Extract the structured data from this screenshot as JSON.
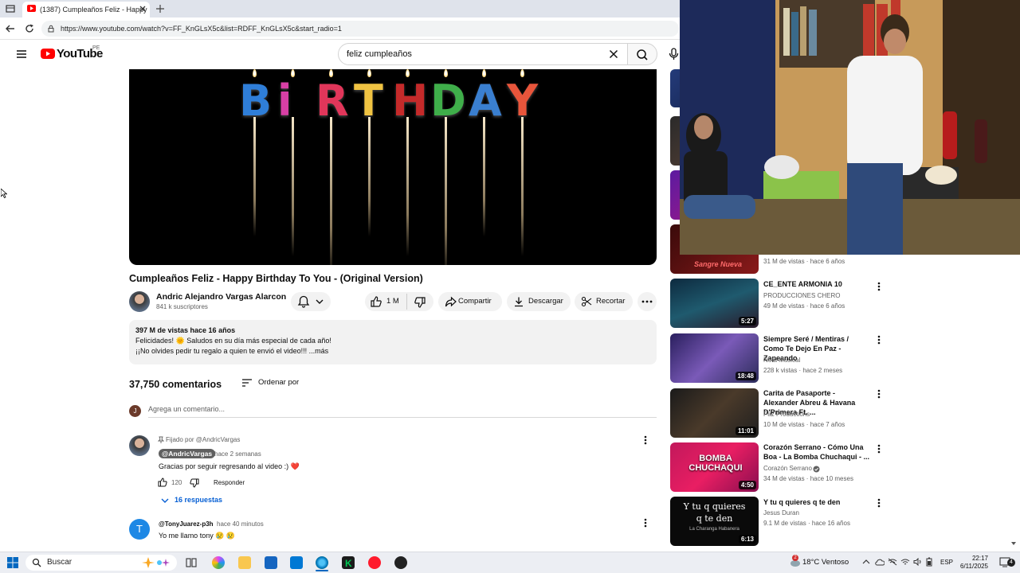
{
  "browser": {
    "tab_title": "(1387) Cumpleaños Feliz - Happy",
    "url": "https://www.youtube.com/watch?v=FF_KnGLsX5c&list=RDFF_KnGLsX5c&start_radio=1"
  },
  "header": {
    "logo_text": "YouTube",
    "country_code": "PE",
    "search_query": "feliz cumpleaños"
  },
  "player": {
    "overlay_letters": [
      "B",
      "i",
      "R",
      "T",
      "H",
      "D",
      "A",
      "Y"
    ],
    "colors": [
      "#2f7ed8",
      "#d83fa5",
      "#e1365a",
      "#f0c342",
      "#c52a2a",
      "#3fae4a",
      "#3a7fd0",
      "#e8553b"
    ]
  },
  "video": {
    "title": "Cumpleaños Feliz - Happy Birthday To You - (Original Version)",
    "channel_name": "Andric Alejandro Vargas Alarcon",
    "subscribers": "841 k suscriptores",
    "likes": "1 M",
    "share_label": "Compartir",
    "download_label": "Descargar",
    "clip_label": "Recortar"
  },
  "description": {
    "views_date": "397 M de vistas  hace 16 años",
    "line1": "Felicidades! 🌞 Saludos en su día más especial de cada año!",
    "line2": "¡¡No olvides pedir tu regalo a quien te envió el video!!! ...más"
  },
  "comments": {
    "count": "37,750 comentarios",
    "sort_label": "Ordenar por",
    "me_initial": "J",
    "add_placeholder": "Agrega un comentario...",
    "pinned": {
      "pinned_by": "Fijado por @AndricVargas",
      "author": "@AndricVargas",
      "time": "hace 2 semanas",
      "text": "Gracias por seguir regresando al video :) ❤️",
      "likes": "120",
      "reply_label": "Responder",
      "replies_label": "16 respuestas"
    },
    "second": {
      "initial": "T",
      "author": "@TonyJuarez-p3h",
      "time": "hace 40 minutos",
      "text": "Yo me llamo tony 😢 😢"
    }
  },
  "related": [
    {
      "title": "CE_ENTE ARMONIA 10",
      "channel": "PRODUCCIONES CHERO",
      "meta": "49 M de vistas · hace 6 años",
      "duration": "5:27"
    },
    {
      "title": "Siempre Seré / Mentiras / Como Te Dejo En Paz - Zapeando",
      "channel": "Nota Musical",
      "meta": "228 k vistas · hace 2 meses",
      "duration": "18:48"
    },
    {
      "title": "Carita de Pasaporte - Alexander Abreu & Havana D'Primera Ft. ...",
      "channel": "Paz Productions",
      "meta": "10 M de vistas · hace 7 años",
      "duration": "11:01"
    },
    {
      "title": "Corazón Serrano - Cómo Una Boa - La Bomba Chuchaqui - ...",
      "channel": "Corazón Serrano",
      "meta": "34 M de vistas · hace 10 meses",
      "duration": "4:50"
    },
    {
      "title": "Y tu q quieres q te den",
      "channel": "Jesus Duran",
      "meta": "9.1 M de vistas · hace 16 años",
      "duration": "6:13"
    }
  ],
  "related_partial_meta": "31 M de vistas · hace 6 años",
  "thumb_texts": {
    "sangre_nueva": "Sangre Nueva",
    "bomba": "BOMBA CHUCHAQUI",
    "ytq_line1": "Y tu q quieres",
    "ytq_line2": "q te den",
    "ytq_line3": "La Charanga Habanera"
  },
  "taskbar": {
    "search_placeholder": "Buscar",
    "weather": "18°C  Ventoso",
    "weather_badge": "2",
    "language": "ESP",
    "time": "22:17",
    "date": "6/11/2025"
  }
}
